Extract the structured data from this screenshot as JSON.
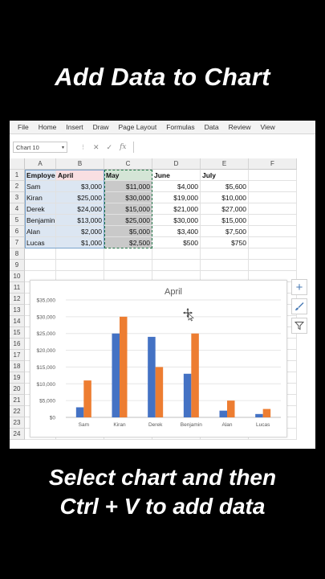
{
  "title": "Add Data to Chart",
  "caption": {
    "line1": "Select chart and then",
    "line2": "Ctrl + V to add data"
  },
  "menu": [
    "File",
    "Home",
    "Insert",
    "Draw",
    "Page Layout",
    "Formulas",
    "Data",
    "Review",
    "View"
  ],
  "name_box": "Chart 10",
  "formula_icons": {
    "cancel": "✕",
    "enter": "✓",
    "fx": "fx"
  },
  "columns": [
    "A",
    "B",
    "C",
    "D",
    "E",
    "F"
  ],
  "rows": [
    "1",
    "2",
    "3",
    "4",
    "5",
    "6",
    "7",
    "8",
    "9",
    "10",
    "11",
    "12",
    "13",
    "14",
    "15",
    "16",
    "17",
    "18",
    "19",
    "20",
    "21",
    "22",
    "23",
    "24"
  ],
  "table": {
    "headers": [
      "Employee",
      "April",
      "May",
      "June",
      "July"
    ],
    "data": [
      [
        "Sam",
        "$3,000",
        "$11,000",
        "$4,000",
        "$5,600"
      ],
      [
        "Kiran",
        "$25,000",
        "$30,000",
        "$19,000",
        "$10,000"
      ],
      [
        "Derek",
        "$24,000",
        "$15,000",
        "$21,000",
        "$27,000"
      ],
      [
        "Benjamin",
        "$13,000",
        "$25,000",
        "$30,000",
        "$15,000"
      ],
      [
        "Alan",
        "$2,000",
        "$5,000",
        "$3,400",
        "$7,500"
      ],
      [
        "Lucas",
        "$1,000",
        "$2,500",
        "$500",
        "$750"
      ]
    ]
  },
  "chart_data": {
    "type": "bar",
    "title": "April",
    "categories": [
      "Sam",
      "Kiran",
      "Derek",
      "Benjamin",
      "Alan",
      "Lucas"
    ],
    "series": [
      {
        "values": [
          3000,
          25000,
          24000,
          13000,
          2000,
          1000
        ],
        "color": "#4472c4"
      },
      {
        "values": [
          11000,
          30000,
          15000,
          25000,
          5000,
          2500
        ],
        "color": "#ed7d31"
      }
    ],
    "ylim": [
      0,
      35000
    ],
    "yticks": [
      "$0",
      "$5,000",
      "$10,000",
      "$15,000",
      "$20,000",
      "$25,000",
      "$30,000",
      "$35,000"
    ],
    "ytick_values": [
      0,
      5000,
      10000,
      15000,
      20000,
      25000,
      30000,
      35000
    ],
    "grid": true,
    "legend": "none"
  },
  "side_buttons": {
    "add": "+",
    "style": "brush-icon",
    "filter": "filter-icon"
  },
  "colors": {
    "blue": "#4472c4",
    "orange": "#ed7d31",
    "excel_green": "#217346"
  }
}
